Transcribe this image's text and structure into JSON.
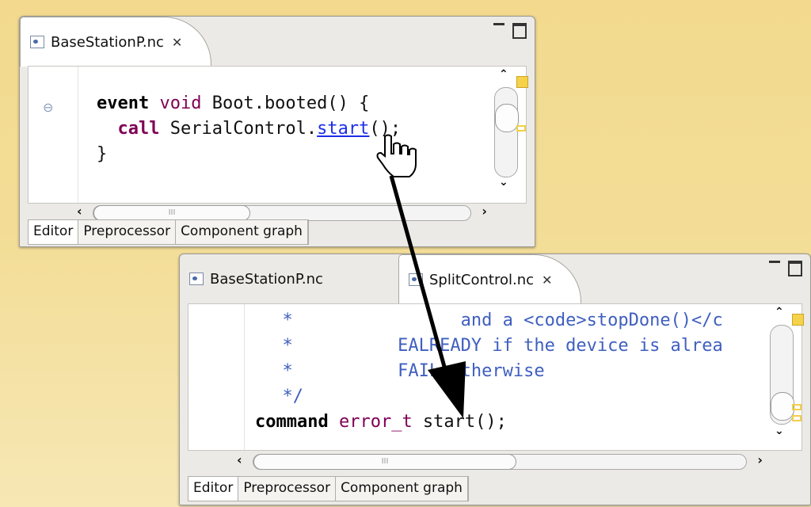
{
  "window_top": {
    "tab_label": "BaseStationP.nc",
    "code": {
      "line1": {
        "kw": "event",
        "kw2": "void",
        "rest": " Boot.booted() {"
      },
      "line2": {
        "kw": "call",
        "pre": " SerialControl.",
        "link": "start",
        "post": "();"
      },
      "line3": "}"
    },
    "bottom_tabs": [
      "Editor",
      "Preprocessor",
      "Component graph"
    ],
    "hscroll_grip": "III"
  },
  "window_bottom": {
    "tab_inactive": "BaseStationP.nc",
    "tab_active": "SplitControl.nc",
    "code": {
      "c1": "  *                and a <code>stopDone()</c",
      "c2": "  *          EALREADY if the device is alrea",
      "c3": "  *          FAIL otherwise",
      "c4": "  */",
      "decl": {
        "kw": "command",
        "type": "error_t",
        "rest": " start();"
      }
    },
    "bottom_tabs": [
      "Editor",
      "Preprocessor",
      "Component graph"
    ],
    "hscroll_grip": "III"
  },
  "icons": [
    "file-icon",
    "close-tab-icon",
    "minimize-icon",
    "maximize-icon",
    "fold-minus-icon",
    "hand-cursor-icon",
    "navigation-arrow"
  ],
  "colors": {
    "keyword": "#7f0055",
    "link": "#1c2fe8",
    "comment": "#3f5fbf",
    "background": "#f2d98e"
  }
}
